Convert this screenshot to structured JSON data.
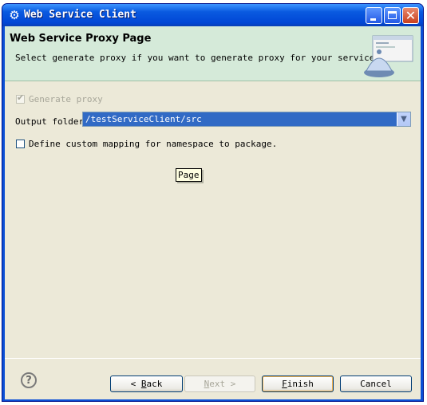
{
  "window": {
    "title": "Web Service Client"
  },
  "banner": {
    "title": "Web Service Proxy Page",
    "description": "Select generate proxy if you want to generate proxy for your service."
  },
  "form": {
    "generate_proxy": {
      "label": "Generate proxy",
      "checked": true,
      "enabled": false
    },
    "output_folder": {
      "label": "Output folder",
      "value": "/testServiceClient/src"
    },
    "custom_mapping": {
      "label": "Define custom mapping for namespace to package.",
      "checked": false
    }
  },
  "tooltip": {
    "text": "Page"
  },
  "buttons": {
    "back": {
      "arrow": "<",
      "label": "Back",
      "mnemonic": "B"
    },
    "next": {
      "label": "Next",
      "arrow": ">",
      "mnemonic": "N",
      "enabled": false
    },
    "finish": {
      "label": "Finish",
      "mnemonic": "F"
    },
    "cancel": {
      "label": "Cancel"
    }
  },
  "help": {
    "glyph": "?"
  },
  "colors": {
    "titlebar": "#0a5ae0",
    "banner_bg": "#d5ead9",
    "dialog_bg": "#ece9d8",
    "selection": "#316ac5"
  }
}
